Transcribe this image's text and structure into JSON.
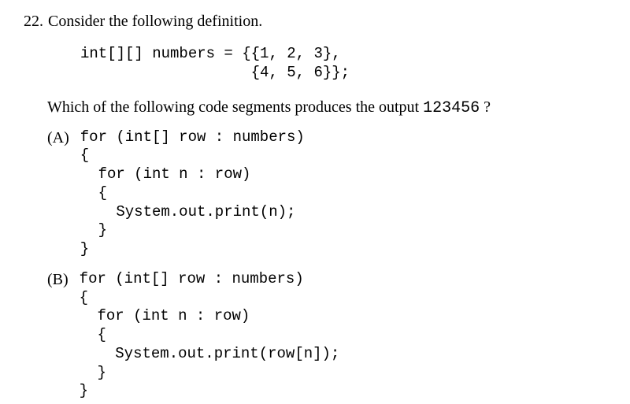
{
  "question": {
    "number": "22.",
    "text": "Consider the following definition."
  },
  "definition": "int[][] numbers = {{1, 2, 3},\n                   {4, 5, 6}};",
  "subquestion": {
    "prefix": "Which of the following code segments produces the output  ",
    "output": "123456",
    "suffix": " ?"
  },
  "options": [
    {
      "label": "(A)",
      "code": "for (int[] row : numbers)\n{\n  for (int n : row)\n  {\n    System.out.print(n);\n  }\n}"
    },
    {
      "label": "(B)",
      "code": "for (int[] row : numbers)\n{\n  for (int n : row)\n  {\n    System.out.print(row[n]);\n  }\n}"
    }
  ]
}
